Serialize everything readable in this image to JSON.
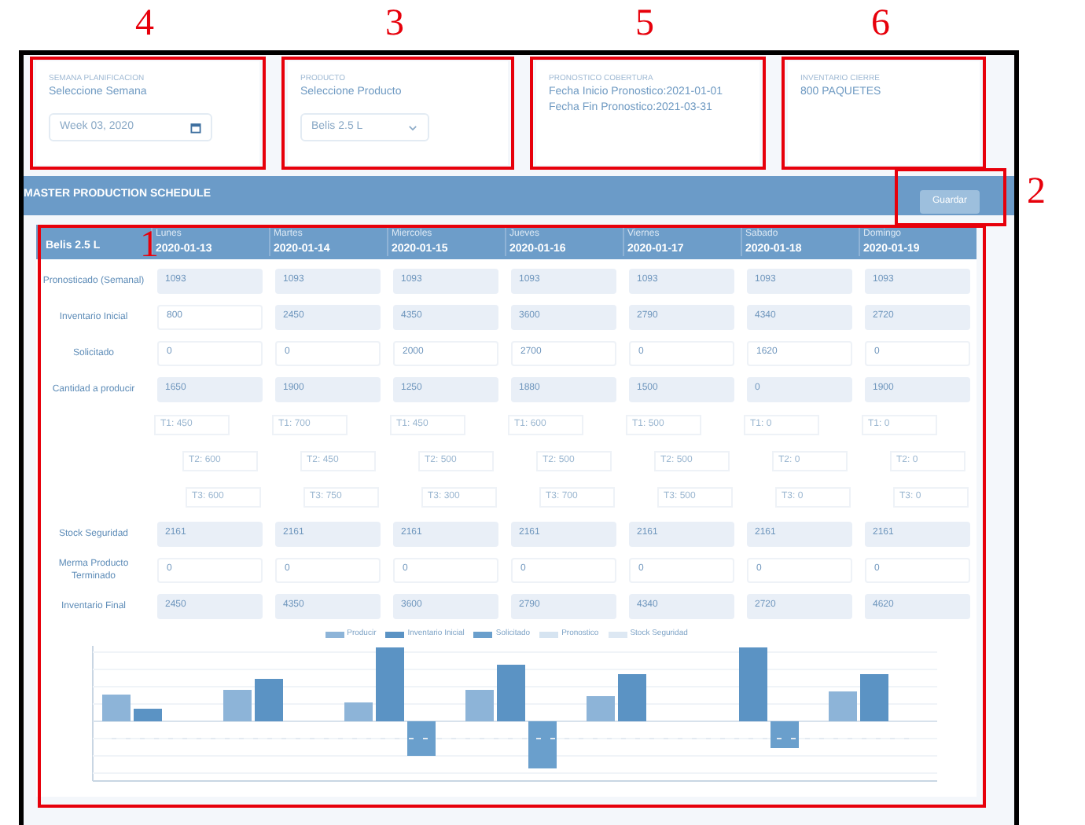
{
  "cards": [
    {
      "kind": "week",
      "annotation": "4",
      "caption": "SEMANA PLANIFICACION",
      "label": "Seleccione Semana",
      "value": "Week 03, 2020"
    },
    {
      "kind": "select",
      "annotation": "3",
      "caption": "PRODUCTO",
      "label": "Seleccione Producto",
      "value": "Belis 2.5 L"
    },
    {
      "kind": "text",
      "annotation": "5",
      "caption": "PRONOSTICO COBERTURA",
      "lines": [
        "Fecha Inicio Pronostico:2021-01-01",
        "Fecha Fin Pronostico:2021-03-31"
      ]
    },
    {
      "kind": "text",
      "annotation": "6",
      "caption": "INVENTARIO CIERRE",
      "lines": [
        "800 PAQUETES"
      ]
    }
  ],
  "toolbar": {
    "title": "MASTER PRODUCTION SCHEDULE",
    "save_button": {
      "label": "Guardar",
      "annotation": "2"
    }
  },
  "table": {
    "annotation": "1",
    "product": "Belis 2.5 L",
    "days": [
      {
        "day": "Lunes",
        "date": "2020-01-13"
      },
      {
        "day": "Martes",
        "date": "2020-01-14"
      },
      {
        "day": "Miercoles",
        "date": "2020-01-15"
      },
      {
        "day": "Jueves",
        "date": "2020-01-16"
      },
      {
        "day": "Viernes",
        "date": "2020-01-17"
      },
      {
        "day": "Sabado",
        "date": "2020-01-18"
      },
      {
        "day": "Domingo",
        "date": "2020-01-19"
      }
    ],
    "rows": [
      {
        "kind": "field",
        "label": "Pronosticado (Semanal)",
        "cells": [
          {
            "value": "1093",
            "readonly": true
          },
          {
            "value": "1093",
            "readonly": true
          },
          {
            "value": "1093",
            "readonly": true
          },
          {
            "value": "1093",
            "readonly": true
          },
          {
            "value": "1093",
            "readonly": true
          },
          {
            "value": "1093",
            "readonly": true
          },
          {
            "value": "1093",
            "readonly": true
          }
        ]
      },
      {
        "kind": "field",
        "label": "Inventario Inicial",
        "cells": [
          {
            "value": "800",
            "readonly": false
          },
          {
            "value": "2450",
            "readonly": true
          },
          {
            "value": "4350",
            "readonly": true
          },
          {
            "value": "3600",
            "readonly": true
          },
          {
            "value": "2790",
            "readonly": true
          },
          {
            "value": "4340",
            "readonly": true
          },
          {
            "value": "2720",
            "readonly": true
          }
        ]
      },
      {
        "kind": "field",
        "label": "Solicitado",
        "cells": [
          {
            "value": "0",
            "readonly": false
          },
          {
            "value": "0",
            "readonly": false
          },
          {
            "value": "2000",
            "readonly": false
          },
          {
            "value": "2700",
            "readonly": false
          },
          {
            "value": "0",
            "readonly": false
          },
          {
            "value": "1620",
            "readonly": false
          },
          {
            "value": "0",
            "readonly": false
          }
        ]
      },
      {
        "kind": "field",
        "label": "Cantidad a producir",
        "cells": [
          {
            "value": "1650",
            "readonly": true
          },
          {
            "value": "1900",
            "readonly": true
          },
          {
            "value": "1250",
            "readonly": true
          },
          {
            "value": "1880",
            "readonly": true
          },
          {
            "value": "1500",
            "readonly": true
          },
          {
            "value": "0",
            "readonly": true
          },
          {
            "value": "1900",
            "readonly": true
          }
        ]
      },
      {
        "kind": "shift",
        "cells": [
          "T1: 450",
          "T1: 700",
          "T1: 450",
          "T1: 600",
          "T1: 500",
          "T1: 0",
          "T1: 0"
        ]
      },
      {
        "kind": "shift",
        "cells": [
          "T2: 600",
          "T2: 450",
          "T2: 500",
          "T2: 500",
          "T2: 500",
          "T2: 0",
          "T2: 0"
        ]
      },
      {
        "kind": "shift",
        "cells": [
          "T3: 600",
          "T3: 750",
          "T3: 300",
          "T3: 700",
          "T3: 500",
          "T3: 0",
          "T3: 0"
        ]
      },
      {
        "kind": "field",
        "label": "Stock Seguridad",
        "cells": [
          {
            "value": "2161",
            "readonly": true
          },
          {
            "value": "2161",
            "readonly": true
          },
          {
            "value": "2161",
            "readonly": true
          },
          {
            "value": "2161",
            "readonly": true
          },
          {
            "value": "2161",
            "readonly": true
          },
          {
            "value": "2161",
            "readonly": true
          },
          {
            "value": "2161",
            "readonly": true
          }
        ]
      },
      {
        "kind": "field",
        "label": "Merma Producto Terminado",
        "cells": [
          {
            "value": "0",
            "readonly": false
          },
          {
            "value": "0",
            "readonly": false
          },
          {
            "value": "0",
            "readonly": false
          },
          {
            "value": "0",
            "readonly": false
          },
          {
            "value": "0",
            "readonly": false
          },
          {
            "value": "0",
            "readonly": false
          },
          {
            "value": "0",
            "readonly": false
          }
        ]
      },
      {
        "kind": "field",
        "label": "Inventario Final",
        "cells": [
          {
            "value": "2450",
            "readonly": true
          },
          {
            "value": "4350",
            "readonly": true
          },
          {
            "value": "3600",
            "readonly": true
          },
          {
            "value": "2790",
            "readonly": true
          },
          {
            "value": "4340",
            "readonly": true
          },
          {
            "value": "2720",
            "readonly": true
          },
          {
            "value": "4620",
            "readonly": true
          }
        ]
      }
    ],
    "legend": [
      {
        "label": "Producir",
        "color": "#8db4d8"
      },
      {
        "label": "Inventario Inicial",
        "color": "#5b93c4"
      },
      {
        "label": "Solicitado",
        "color": "#6a9fcc"
      },
      {
        "label": "Pronostico",
        "color": "#d6e4f1"
      },
      {
        "label": "Stock Seguridad",
        "color": "#dde8f3"
      }
    ]
  }
}
